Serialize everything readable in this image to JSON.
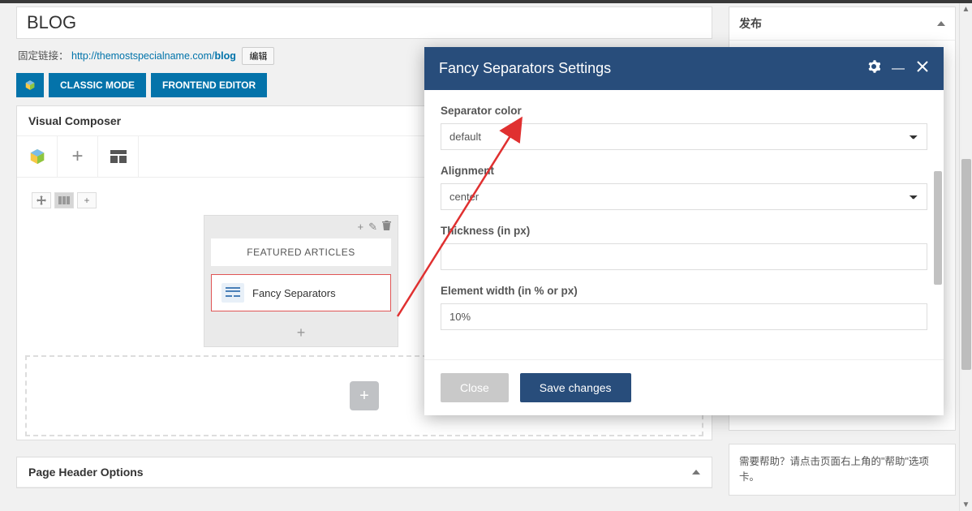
{
  "title": "BLOG",
  "permalink": {
    "label": "固定链接：",
    "url_base": "http://themostspecialname.com/",
    "url_slug": "blog",
    "edit": "编辑"
  },
  "vc_buttons": {
    "classic": "CLASSIC MODE",
    "frontend": "FRONTEND EDITOR"
  },
  "composer": {
    "title": "Visual Composer",
    "featured_title": "FEATURED ARTICLES",
    "element_label": "Fancy Separators"
  },
  "page_header_panel": "Page Header Options",
  "sidebar": {
    "publish_title": "发布",
    "help_text": "需要帮助？请点击页面右上角的\"帮助\"选项卡。"
  },
  "modal": {
    "title": "Fancy Separators Settings",
    "fields": {
      "color_label": "Separator color",
      "color_value": "default",
      "align_label": "Alignment",
      "align_value": "center",
      "thickness_label": "Thickness (in px)",
      "thickness_value": "",
      "width_label": "Element width (in % or px)",
      "width_value": "10%"
    },
    "close": "Close",
    "save": "Save changes"
  }
}
